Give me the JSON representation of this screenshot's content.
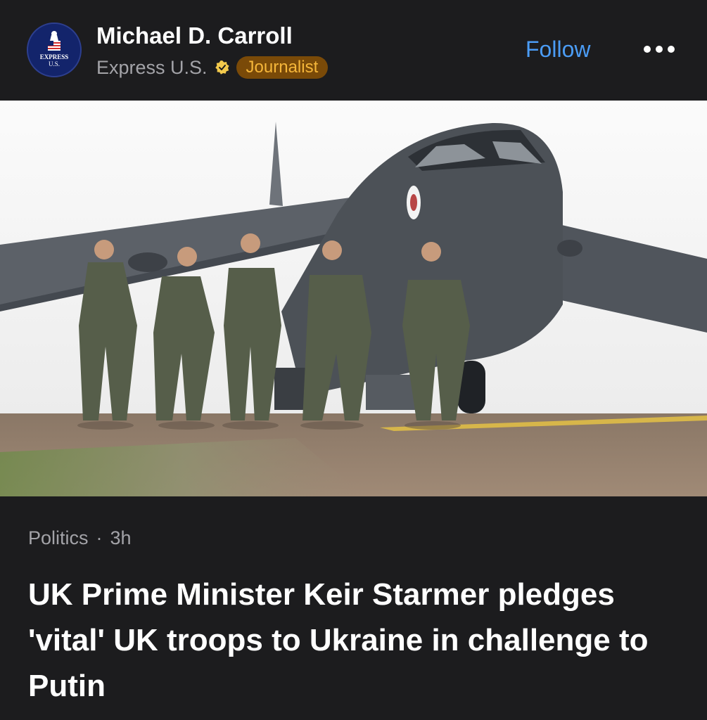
{
  "header": {
    "avatar_text_top": "EXPRESS",
    "avatar_text_bottom": "U.S.",
    "author_name": "Michael D. Carroll",
    "source_name": "Express U.S.",
    "badge_label": "Journalist",
    "follow_label": "Follow",
    "more_icon": "more-horizontal-icon"
  },
  "photo": {
    "description_icon": "article-image"
  },
  "article": {
    "category": "Politics",
    "separator": "·",
    "time_ago": "3h",
    "headline": "UK Prime Minister Keir Starmer pledges 'vital' UK troops to Ukraine in challenge to Putin"
  },
  "colors": {
    "background": "#1c1c1e",
    "accent_blue": "#4b9cf5",
    "badge_bg": "#7a4a08",
    "badge_text": "#f5b63a",
    "muted_text": "#a3a3a8"
  }
}
